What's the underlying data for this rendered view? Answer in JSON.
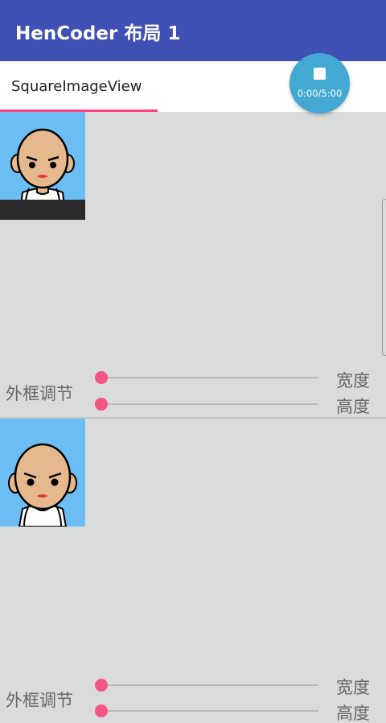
{
  "appbar": {
    "title": "HenCoder 布局 1",
    "color": "#3f51b5"
  },
  "tabs": [
    {
      "label": "SquareImageView",
      "selected": true
    }
  ],
  "fab": {
    "icon": "stop-icon",
    "time": "0:00/5:00",
    "color": "#43a9d3"
  },
  "sections": [
    {
      "control_label": "外框调节",
      "width_label": "宽度",
      "height_label": "高度",
      "width_value": 0,
      "height_value": 0
    },
    {
      "control_label": "外框调节",
      "width_label": "宽度",
      "height_label": "高度",
      "width_value": 0,
      "height_value": 0
    }
  ],
  "colors": {
    "accent": "#ff4081",
    "slider_thumb": "#f45581",
    "avatar_bg": "#6dbdf5",
    "background": "#dadcdb"
  }
}
